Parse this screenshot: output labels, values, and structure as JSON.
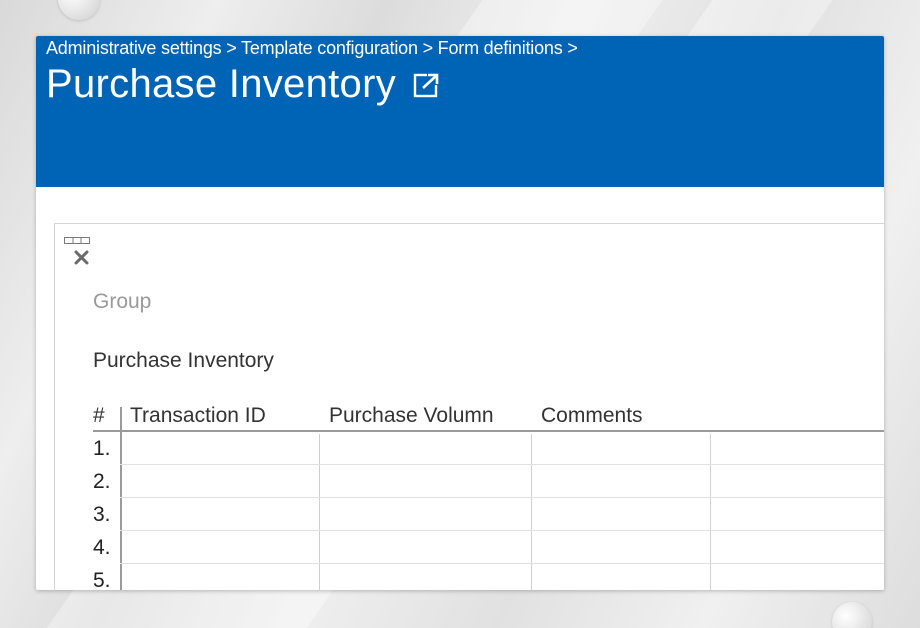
{
  "header": {
    "breadcrumb": "Administrative settings > Template configuration > Form definitions >",
    "title": "Purchase Inventory",
    "background_color": "#0064b6",
    "external_link_icon": "external-link-icon"
  },
  "panel": {
    "toolbar_icons": [
      "drag-handle-icon",
      "close-icon"
    ],
    "group_label": "Group",
    "section_title": "Purchase Inventory",
    "table": {
      "columns": [
        "#",
        "Transaction ID",
        "Purchase Volumn",
        "Comments"
      ],
      "rows": [
        {
          "num": "1.",
          "cells": [
            "",
            "",
            "",
            ""
          ]
        },
        {
          "num": "2.",
          "cells": [
            "",
            "",
            "",
            ""
          ]
        },
        {
          "num": "3.",
          "cells": [
            "",
            "",
            "",
            ""
          ]
        },
        {
          "num": "4.",
          "cells": [
            "",
            "",
            "",
            ""
          ]
        },
        {
          "num": "5.",
          "cells": [
            "",
            "",
            "",
            ""
          ]
        }
      ]
    }
  }
}
